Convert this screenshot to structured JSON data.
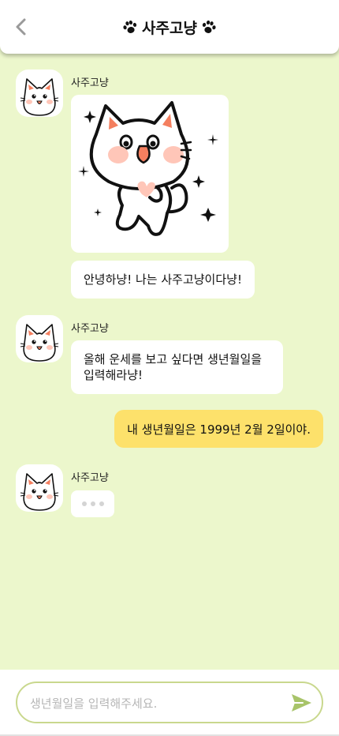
{
  "header": {
    "title": "사주고냥"
  },
  "messages": {
    "bot_name": "사주고냥",
    "greeting": "안녕하냥! 나는 사주고냥이다냥!",
    "ask_line1": "올해 운세를 보고 싶다면 생년월일을",
    "ask_line2": "입력해라냥!",
    "user_reply": "내 생년월일은 1999년 2월 2일이야."
  },
  "input": {
    "placeholder": "생년월일을 입력해주세요.",
    "value": ""
  },
  "colors": {
    "background": "#ecf7cc",
    "user_bubble": "#fde16b",
    "send_icon": "#a8c46a",
    "input_border": "#c9d88e",
    "cat_accent": "#f47f5f"
  },
  "icons": {
    "back": "chevron-left-icon",
    "title_decoration": "paw-icon",
    "send": "paper-plane-icon",
    "avatar": "cat-avatar",
    "typing": "typing-dots-icon"
  }
}
